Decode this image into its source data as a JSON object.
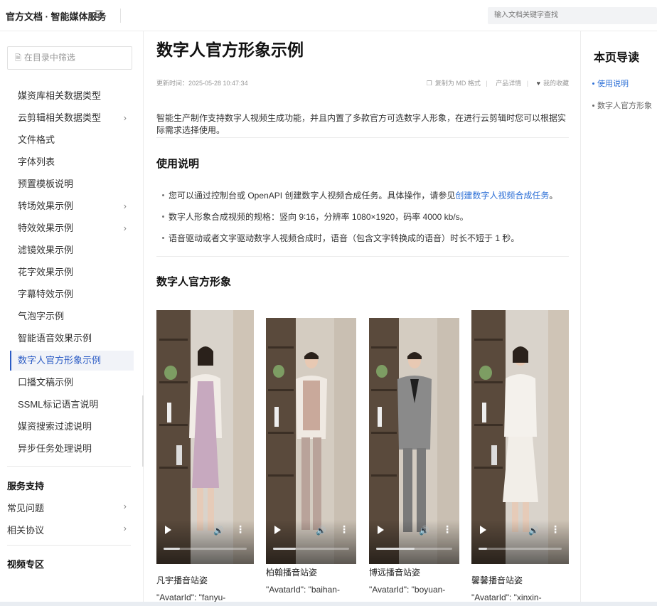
{
  "header": {
    "brand": "官方文档 · 智能媒体服务",
    "search_placeholder": "输入文档关键字查找"
  },
  "sidebar": {
    "filter_placeholder": "在目录中筛选",
    "items": [
      {
        "label": "媒资库相关数据类型",
        "has_children": false,
        "active": false
      },
      {
        "label": "云剪辑相关数据类型",
        "has_children": true,
        "active": false
      },
      {
        "label": "文件格式",
        "has_children": false,
        "active": false
      },
      {
        "label": "字体列表",
        "has_children": false,
        "active": false
      },
      {
        "label": "预置模板说明",
        "has_children": false,
        "active": false
      },
      {
        "label": "转场效果示例",
        "has_children": true,
        "active": false
      },
      {
        "label": "特效效果示例",
        "has_children": true,
        "active": false
      },
      {
        "label": "滤镜效果示例",
        "has_children": false,
        "active": false
      },
      {
        "label": "花字效果示例",
        "has_children": false,
        "active": false
      },
      {
        "label": "字幕特效示例",
        "has_children": false,
        "active": false
      },
      {
        "label": "气泡字示例",
        "has_children": false,
        "active": false
      },
      {
        "label": "智能语音效果示例",
        "has_children": false,
        "active": false
      },
      {
        "label": "数字人官方形象示例",
        "has_children": false,
        "active": true
      },
      {
        "label": "口播文稿示例",
        "has_children": false,
        "active": false
      },
      {
        "label": "SSML标记语言说明",
        "has_children": false,
        "active": false
      },
      {
        "label": "媒资搜索过滤说明",
        "has_children": false,
        "active": false
      },
      {
        "label": "异步任务处理说明",
        "has_children": false,
        "active": false
      }
    ],
    "service_support": {
      "title": "服务支持",
      "items": [
        {
          "label": "常见问题"
        },
        {
          "label": "相关协议"
        }
      ]
    },
    "video_zone": {
      "title": "视频专区"
    }
  },
  "main": {
    "title": "数字人官方形象示例",
    "updated": "更新时间：2025-05-28 10:47:34",
    "actions": {
      "copy_md": "复制为 MD 格式",
      "product_details": "产品详情",
      "favorite": "我的收藏"
    },
    "intro": "智能生产制作支持数字人视频生成功能，并且内置了多款官方可选数字人形象，在进行云剪辑时您可以根据实际需求选择使用。",
    "usage": {
      "heading": "使用说明",
      "bullet1_prefix": "您可以通过控制台或 OpenAPI 创建数字人视频合成任务。具体操作，请参见",
      "bullet1_link": "创建数字人视频合成任务",
      "bullet1_suffix": "。",
      "bullet2": "数字人形象合成视频的规格：竖向 9∶16，分辨率 1080×1920，码率 4000 kb/s。",
      "bullet3": "语音驱动或者文字驱动数字人视频合成时，语音（包含文字转换成的语音）时长不短于 1 秒。"
    },
    "avatars": {
      "heading": "数字人官方形象",
      "cards": [
        {
          "name": "凡宇播音站姿",
          "code": "\"AvatarId\": \"fanyu-",
          "progress": 0.2
        },
        {
          "name": "柏翰播音站姿",
          "code": "\"AvatarId\": \"baihan-",
          "progress": 0.3
        },
        {
          "name": "博远播音站姿",
          "code": "\"AvatarId\": \"boyuan-",
          "progress": 0.5
        },
        {
          "name": "馨馨播音站姿",
          "code": "\"AvatarId\": \"xinxin-",
          "progress": 0.1
        }
      ]
    }
  },
  "toc": {
    "title": "本页导读",
    "items": [
      {
        "label": "使用说明",
        "active": true
      },
      {
        "label": "数字人官方形象",
        "active": false
      }
    ]
  },
  "colors": {
    "accent": "#2c6fd6",
    "active_nav_bg": "#f1f3f8"
  }
}
